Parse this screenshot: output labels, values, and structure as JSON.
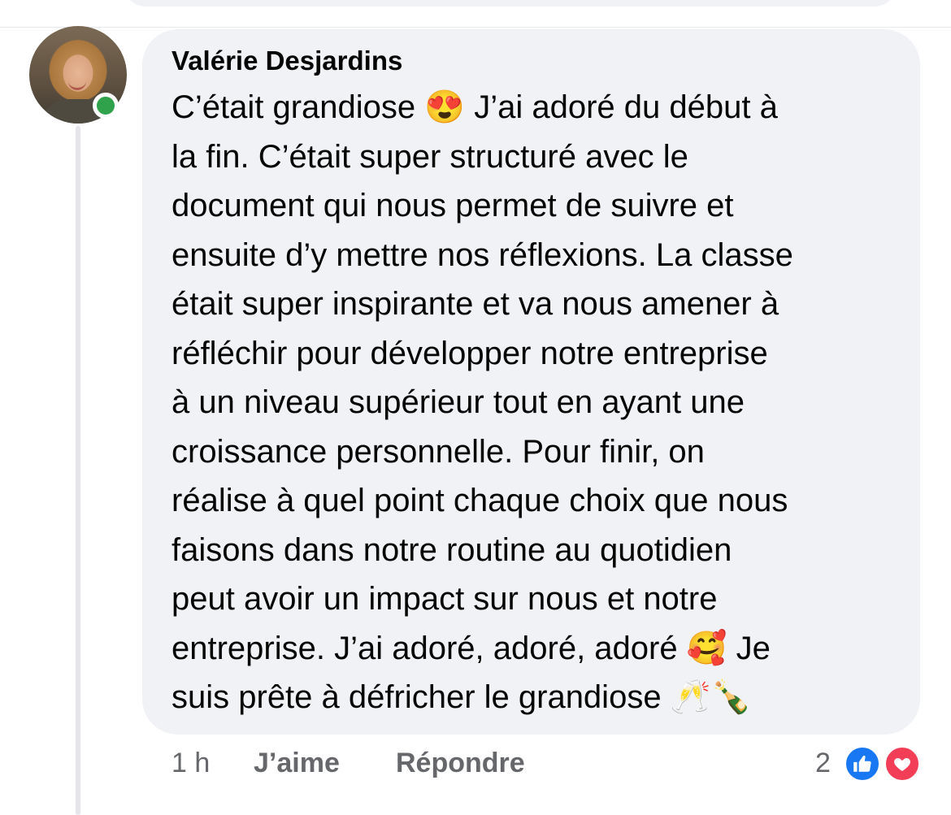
{
  "comment": {
    "author": "Valérie Desjardins",
    "lines": [
      "C’était grandiose 😍 J’ai adoré du début à",
      "la fin. C’était super structuré avec le",
      "document qui nous permet de suivre et",
      "ensuite d’y mettre nos réflexions. La classe",
      "était super inspirante et va nous amener à",
      "réfléchir pour développer notre entreprise",
      "à un niveau supérieur tout en ayant une",
      "croissance personnelle. Pour finir, on",
      "réalise à quel point chaque choix que nous",
      "faisons dans notre routine au quotidien",
      "peut avoir un impact sur nous et notre",
      "entreprise. J’ai adoré, adoré, adoré 🥰 Je",
      "suis prête à défricher le grandiose 🥂🍾"
    ],
    "time": "1 h",
    "like_label": "J’aime",
    "reply_label": "Répondre",
    "reaction_count": "2",
    "reactions": [
      "like-icon",
      "love-icon"
    ]
  },
  "colors": {
    "bubble": "#f0f2f5",
    "online": "#31a24c",
    "like": "#1877f2",
    "love": "#f33e58",
    "meta_text": "#65676b"
  }
}
